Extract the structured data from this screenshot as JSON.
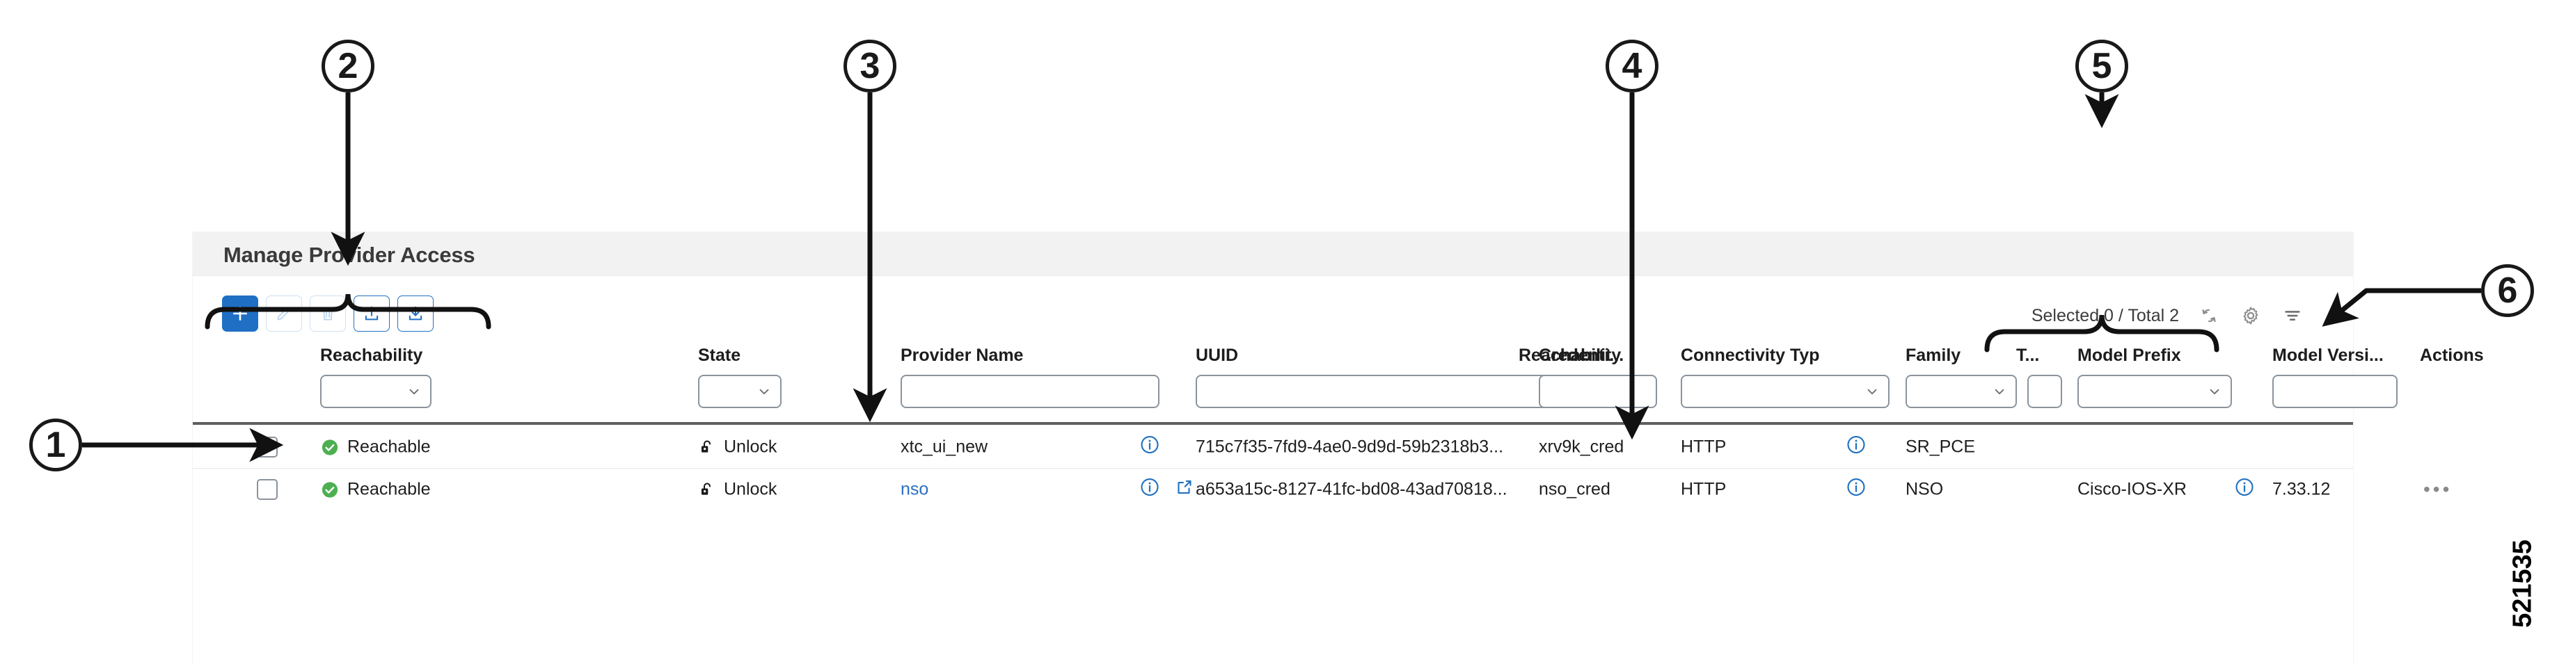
{
  "panel": {
    "title": "Manage Provider Access"
  },
  "toolbar": {
    "buttons": [
      {
        "name": "add-button",
        "icon": "plus-icon",
        "state": "primary"
      },
      {
        "name": "edit-button",
        "icon": "pencil-icon",
        "state": "disabled"
      },
      {
        "name": "delete-button",
        "icon": "trash-icon",
        "state": "disabled"
      },
      {
        "name": "import-button",
        "icon": "upload-icon",
        "state": "outline"
      },
      {
        "name": "export-button",
        "icon": "download-icon",
        "state": "outline"
      }
    ]
  },
  "status": {
    "summary": "Selected 0 / Total 2",
    "refresh_icon": "refresh-icon",
    "settings_icon": "gear-icon",
    "filter_icon": "filter-icon"
  },
  "table": {
    "columns": [
      {
        "key": "checkbox",
        "label": ""
      },
      {
        "key": "reachability",
        "label": "Reachability",
        "filter": "dropdown"
      },
      {
        "key": "state",
        "label": "State",
        "filter": "dropdown"
      },
      {
        "key": "provider",
        "label": "Provider Name",
        "filter": "text"
      },
      {
        "key": "uuid",
        "label": "UUID",
        "filter": "text"
      },
      {
        "key": "credential",
        "label": "Credenti...",
        "filter": "text"
      },
      {
        "key": "connectivity",
        "label": "Connectivity Typ",
        "filter": "text"
      },
      {
        "key": "family",
        "label": "Family",
        "filter": "dropdown"
      },
      {
        "key": "t",
        "label": "T...",
        "filter": "text"
      },
      {
        "key": "model_prefix",
        "label": "Model Prefix",
        "filter": "dropdown"
      },
      {
        "key": "model_version",
        "label": "Model Versi...",
        "filter": "text"
      },
      {
        "key": "actions",
        "label": "Actions",
        "filter": "none"
      }
    ],
    "rows": [
      {
        "checked": false,
        "reachability": "Reachable",
        "reachability_icon": "check-circle-icon",
        "state": "Unlock",
        "state_icon": "unlock-icon",
        "provider": "xtc_ui_new",
        "provider_is_link": false,
        "uuid_info_icon": "info-icon",
        "uuid_external_icon": "",
        "uuid": "715c7f35-7fd9-4ae0-9d9d-59b2318b3...",
        "credential": "xrv9k_cred",
        "connectivity": "HTTP",
        "family_info_icon": "info-icon",
        "family": "SR_PCE",
        "t": "",
        "model_prefix": "",
        "model_prefix_info_icon": "",
        "model_version": "",
        "actions": ""
      },
      {
        "checked": false,
        "reachability": "Reachable",
        "reachability_icon": "check-circle-icon",
        "state": "Unlock",
        "state_icon": "unlock-icon",
        "provider": "nso",
        "provider_is_link": true,
        "uuid_info_icon": "info-icon",
        "uuid_external_icon": "external-link-icon",
        "uuid": "a653a15c-8127-41fc-bd08-43ad70818...",
        "credential": "nso_cred",
        "connectivity": "HTTP",
        "family_info_icon": "info-icon",
        "family": "NSO",
        "t": "",
        "model_prefix": "Cisco-IOS-XR",
        "model_prefix_info_icon": "info-icon",
        "model_version": "7.33.12",
        "actions": "•••"
      }
    ]
  },
  "callouts": [
    {
      "id": "callout-1",
      "label": "1"
    },
    {
      "id": "callout-2",
      "label": "2"
    },
    {
      "id": "callout-3",
      "label": "3"
    },
    {
      "id": "callout-4",
      "label": "4"
    },
    {
      "id": "callout-5",
      "label": "5"
    },
    {
      "id": "callout-6",
      "label": "6"
    }
  ],
  "figure_code": "521535",
  "colors": {
    "accent": "#1f6fc4",
    "link": "#2c6fc6",
    "success": "#4CAF50",
    "header_bg": "#f2f2f2",
    "rule": "#5f5f5f"
  }
}
